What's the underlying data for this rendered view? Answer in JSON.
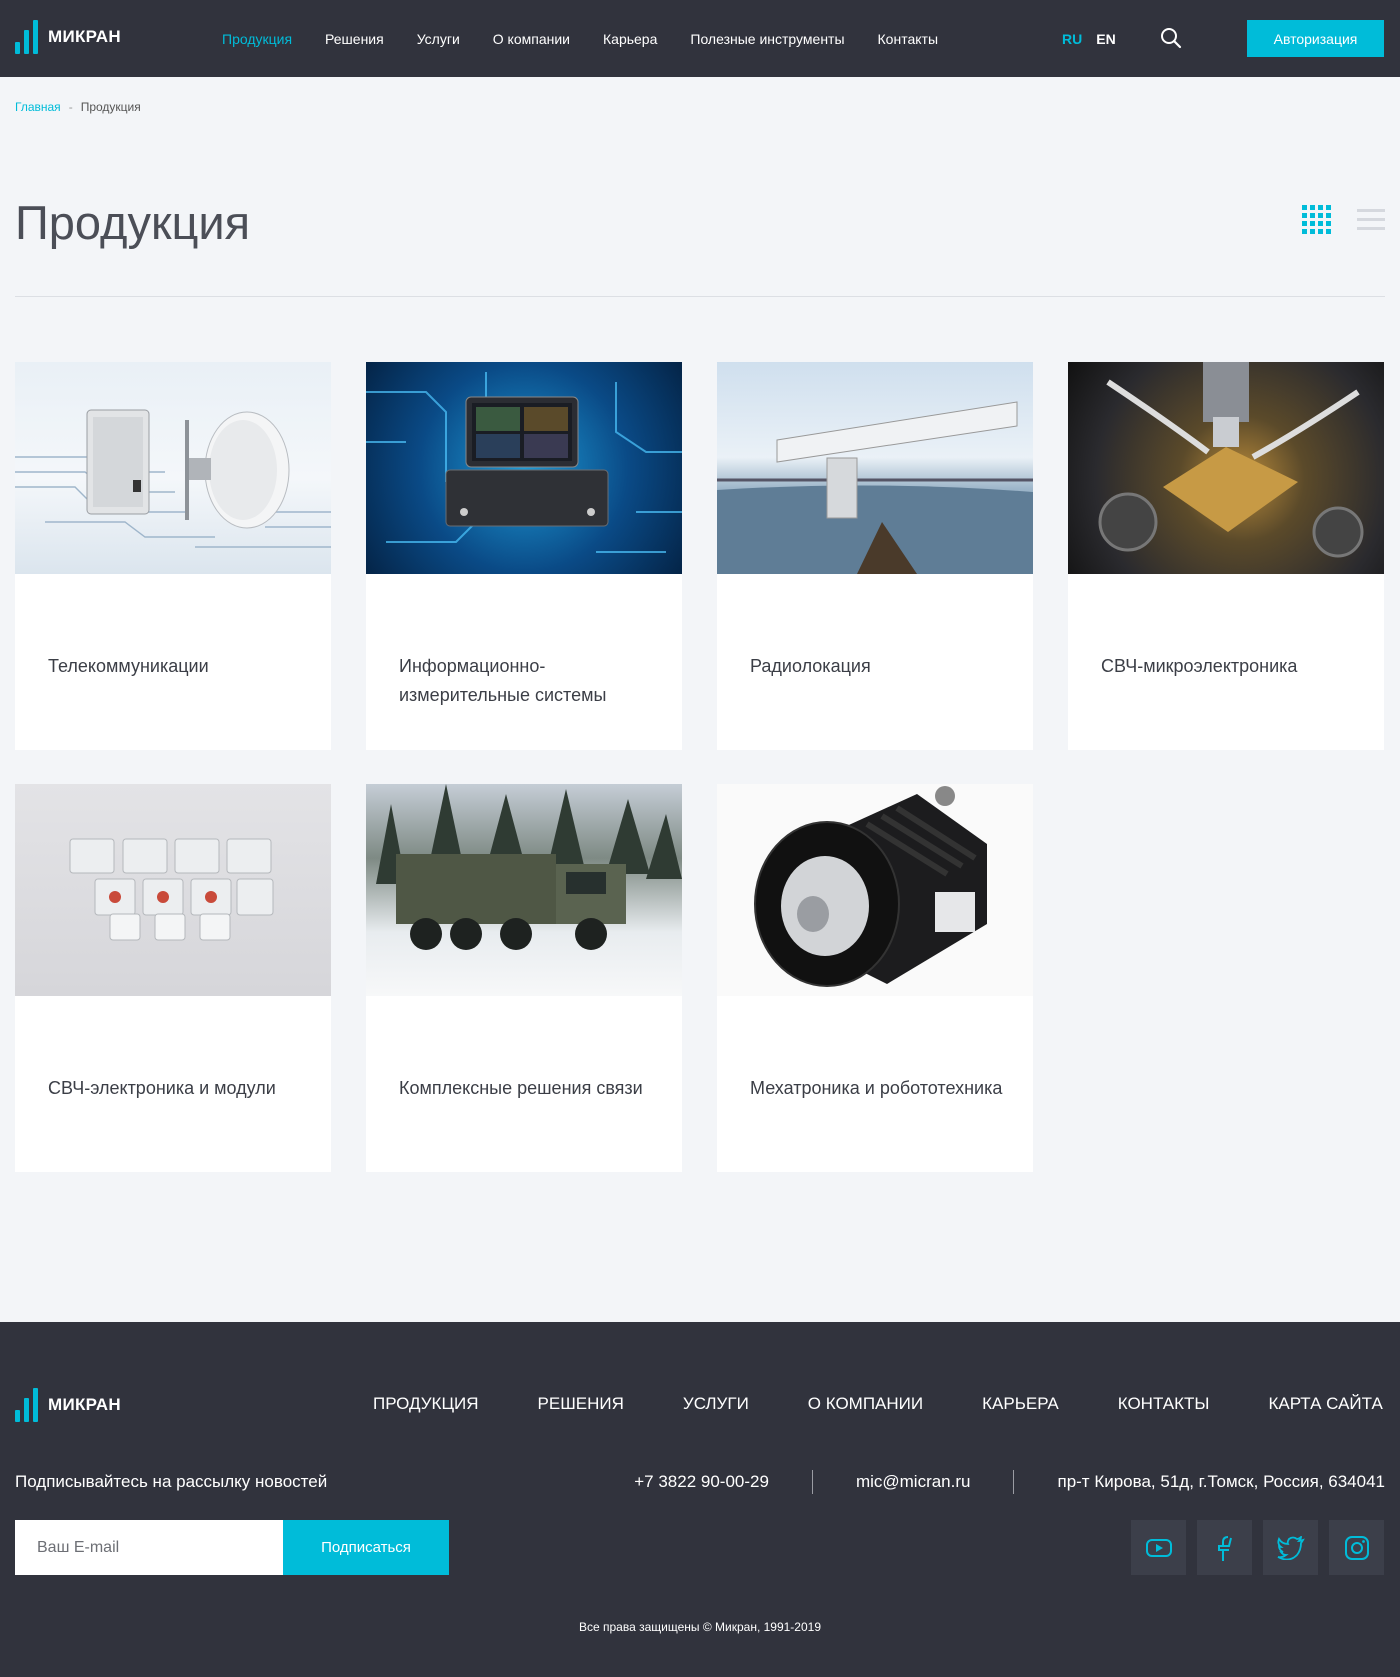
{
  "header": {
    "logo_text": "МИКРАН",
    "nav": [
      "Продукция",
      "Решения",
      "Услуги",
      "О компании",
      "Карьера",
      "Полезные инструменты",
      "Контакты"
    ],
    "lang_ru": "RU",
    "lang_en": "EN",
    "auth_label": "Авторизация"
  },
  "breadcrumb": {
    "home": "Главная",
    "sep": "-",
    "current": "Продукция"
  },
  "page": {
    "title": "Продукция"
  },
  "products": [
    {
      "label": "Телекоммуникации"
    },
    {
      "label": "Информационно-измерительные системы"
    },
    {
      "label": "Радиолокация"
    },
    {
      "label": "СВЧ-микроэлектроника"
    },
    {
      "label": "СВЧ-электроника и модули"
    },
    {
      "label": "Комплексные решения связи"
    },
    {
      "label": "Мехатроника и робототехника"
    }
  ],
  "footer": {
    "logo_text": "МИКРАН",
    "nav": [
      "ПРОДУКЦИЯ",
      "РЕШЕНИЯ",
      "УСЛУГИ",
      "О КОМПАНИИ",
      "КАРЬЕРА",
      "КОНТАКТЫ",
      "КАРТА САЙТА"
    ],
    "subscribe_text": "Подписывайтесь на рассылку новостей",
    "phone": "+7 3822 90-00-29",
    "email": "mic@micran.ru",
    "address": "пр-т Кирова, 51д, г.Томск, Россия, 634041",
    "email_placeholder": "Ваш E-mail",
    "subscribe_label": "Подписаться",
    "copyright": "Все права защищены © Микран, 1991-2019"
  },
  "colors": {
    "accent": "#00bcd9",
    "dark": "#31333d",
    "background": "#f3f5f8"
  }
}
